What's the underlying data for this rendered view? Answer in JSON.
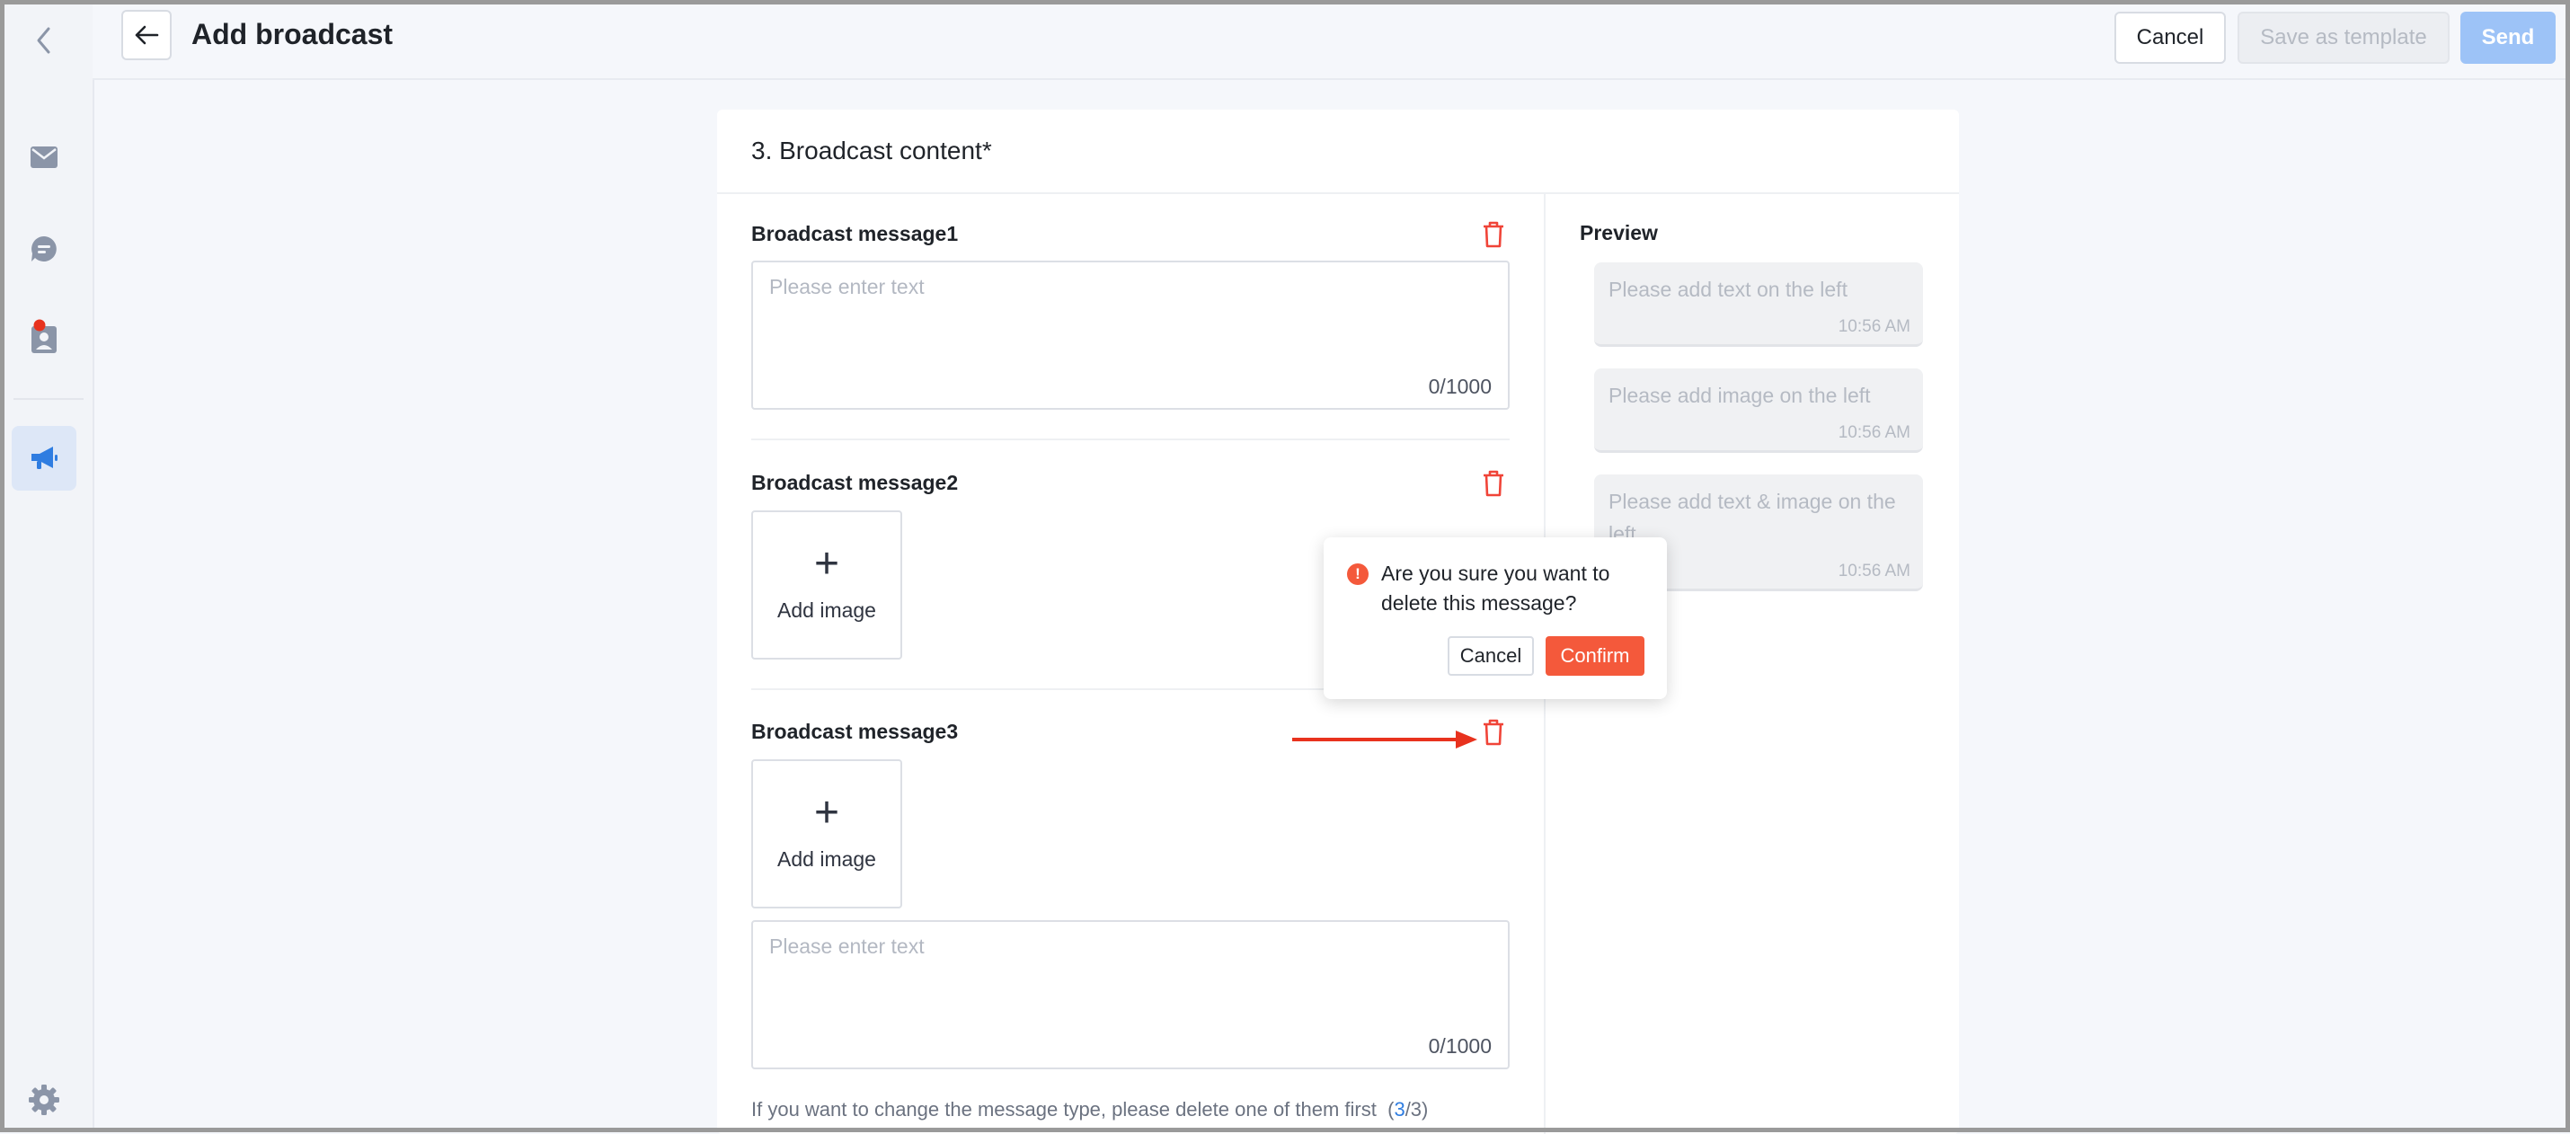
{
  "header": {
    "title": "Add broadcast",
    "cancel_label": "Cancel",
    "save_template_label": "Save as template",
    "send_label": "Send"
  },
  "sidebar": {
    "items": [
      {
        "name": "collapse",
        "icon": "chevron-left-icon"
      },
      {
        "name": "mail",
        "icon": "mail-icon"
      },
      {
        "name": "chat",
        "icon": "chat-icon"
      },
      {
        "name": "contacts",
        "icon": "contact-card-icon",
        "badge": true
      },
      {
        "name": "broadcast",
        "icon": "megaphone-icon",
        "active": true
      },
      {
        "name": "settings",
        "icon": "gear-icon"
      }
    ]
  },
  "content": {
    "section_title": "3. Broadcast content*",
    "messages": [
      {
        "title": "Broadcast message1",
        "text_placeholder": "Please enter text",
        "counter": "0/1000"
      },
      {
        "title": "Broadcast message2",
        "add_image_label": "Add image"
      },
      {
        "title": "Broadcast message3",
        "add_image_label": "Add image",
        "text_placeholder": "Please enter text",
        "counter": "0/1000"
      }
    ],
    "footnote": {
      "text": "If you want to change the message type, please delete one of them first",
      "open": "(",
      "current": "3",
      "total": "/3)"
    }
  },
  "preview": {
    "title": "Preview",
    "bubbles": [
      {
        "text": "Please add text on the left",
        "time": "10:56 AM"
      },
      {
        "text": "Please add image on the left",
        "time": "10:56 AM"
      },
      {
        "text": "Please add text & image on the left",
        "time": "10:56 AM"
      }
    ]
  },
  "popconfirm": {
    "message": "Are you sure you want to delete this message?",
    "cancel_label": "Cancel",
    "confirm_label": "Confirm"
  },
  "colors": {
    "accent": "#2f7de1",
    "danger": "#f4593b",
    "send_disabled": "#9dc3f7",
    "annotation_arrow": "#e8321e"
  }
}
